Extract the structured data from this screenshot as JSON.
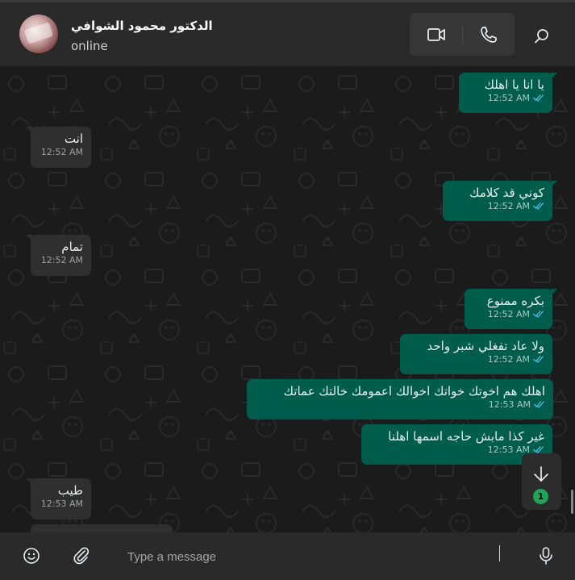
{
  "header": {
    "contact_name": "الدكتور محمود الشوافي",
    "status": "online"
  },
  "messages": [
    {
      "direction": "out",
      "text": "يا انا يا اهلك",
      "time": "12:52 AM"
    },
    {
      "direction": "in",
      "text": "انت",
      "time": "12:52 AM"
    },
    {
      "direction": "out",
      "text": "كوني قد كلامك",
      "time": "12:52 AM"
    },
    {
      "direction": "in",
      "text": "تمام",
      "time": "12:52 AM"
    },
    {
      "direction": "out",
      "text": "بكره ممنوع",
      "time": "12:52 AM"
    },
    {
      "direction": "out",
      "text": "ولا عاد تفغلي شبر واحد",
      "time": "12:52 AM"
    },
    {
      "direction": "out",
      "text": "اهلك هم اخوتك خواتك اخوالك اعمومك خالتك عماتك",
      "time": "12:53 AM"
    },
    {
      "direction": "out",
      "text": "غير كذا مابش حاجه اسمها اهلنا",
      "time": "12:53 AM"
    },
    {
      "direction": "in",
      "text": "طيب",
      "time": "12:53 AM"
    }
  ],
  "scroll_down": {
    "unread_count": "1"
  },
  "composer": {
    "placeholder": "Type a message"
  },
  "colors": {
    "outgoing_bubble": "#005c4b",
    "incoming_bubble": "#2f2f2f",
    "read_tick": "#53bdeb",
    "unread_badge": "#21a35a"
  },
  "icons": [
    "video-call-icon",
    "voice-call-icon",
    "search-icon",
    "emoji-icon",
    "attach-icon",
    "microphone-icon",
    "arrow-down-icon",
    "double-check-icon"
  ]
}
